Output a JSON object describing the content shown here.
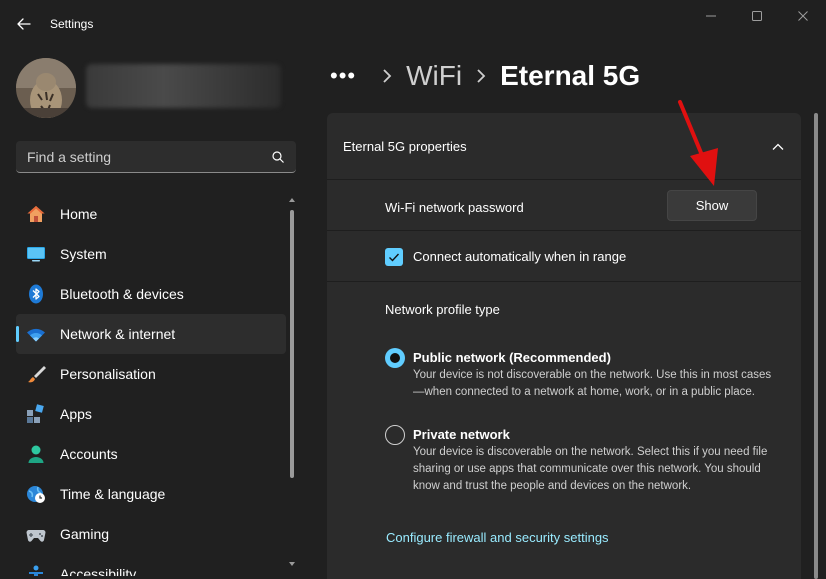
{
  "window": {
    "title": "Settings"
  },
  "search": {
    "placeholder": "Find a setting"
  },
  "sidebar": {
    "items": [
      {
        "label": "Home",
        "icon": "home-icon"
      },
      {
        "label": "System",
        "icon": "monitor-icon"
      },
      {
        "label": "Bluetooth & devices",
        "icon": "bluetooth-icon"
      },
      {
        "label": "Network & internet",
        "icon": "wifi-icon",
        "active": true
      },
      {
        "label": "Personalisation",
        "icon": "paintbrush-icon"
      },
      {
        "label": "Apps",
        "icon": "apps-icon"
      },
      {
        "label": "Accounts",
        "icon": "person-icon"
      },
      {
        "label": "Time & language",
        "icon": "globe-clock-icon"
      },
      {
        "label": "Gaming",
        "icon": "gamepad-icon"
      },
      {
        "label": "Accessibility",
        "icon": "accessibility-icon"
      }
    ]
  },
  "breadcrumb": {
    "more": "•••",
    "parent": "WiFi",
    "current": "Eternal 5G"
  },
  "properties": {
    "title": "Eternal 5G properties",
    "password_label": "Wi-Fi network password",
    "show_button": "Show",
    "auto_connect_label": "Connect automatically when in range",
    "auto_connect_checked": true,
    "profile_type_label": "Network profile type",
    "public": {
      "title": "Public network (Recommended)",
      "description": "Your device is not discoverable on the network. Use this in most cases—when connected to a network at home, work, or in a public place.",
      "selected": true
    },
    "private": {
      "title": "Private network",
      "description": "Your device is discoverable on the network. Select this if you need file sharing or use apps that communicate over this network. You should know and trust the people and devices on the network.",
      "selected": false
    },
    "firewall_link": "Configure firewall and security settings"
  },
  "colors": {
    "accent": "#60cdff",
    "link": "#99ebff",
    "annotation": "#e01010",
    "background": "#202020",
    "card": "#2b2b2b"
  }
}
